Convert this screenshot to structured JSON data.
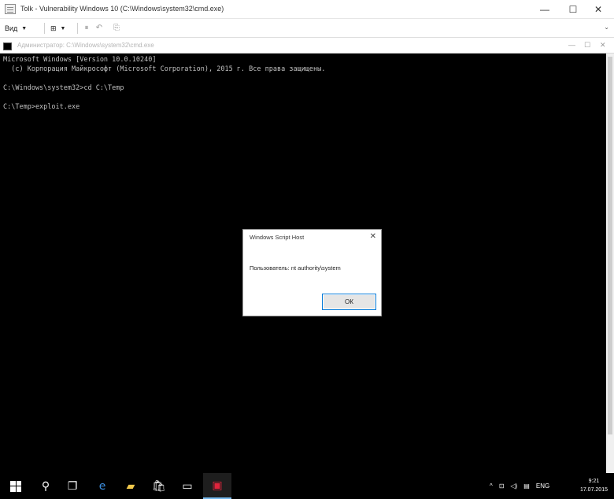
{
  "window": {
    "title": "Tolk - Vulnerability Windows 10 (C:\\Windows\\system32\\cmd.exe)",
    "minimize_glyph": "—",
    "maximize_glyph": "☐",
    "close_glyph": "✕"
  },
  "toolbar": {
    "view_label": "Вид",
    "zoom_label": "⊞",
    "expand_glyph": "⌄"
  },
  "console": {
    "title": "Администратор: C:\\Windows\\system32\\cmd.exe",
    "lines": [
      "Microsoft Windows [Version 10.0.10240]",
      "  (c) Корпорация Майкрософт (Microsoft Corporation), 2015 г. Все права защищены.",
      "",
      "C:\\Windows\\system32>cd C:\\Temp",
      "",
      "C:\\Temp>exploit.exe"
    ]
  },
  "dialog": {
    "title": "Windows Script Host",
    "message": "Пользователь: nt authority\\system",
    "ok_label": "ОК",
    "close_glyph": "✕"
  },
  "taskbar": {
    "clock_time": "9:21",
    "clock_date": "17.07.2015",
    "language": "ENG",
    "tray_up_glyph": "^"
  }
}
